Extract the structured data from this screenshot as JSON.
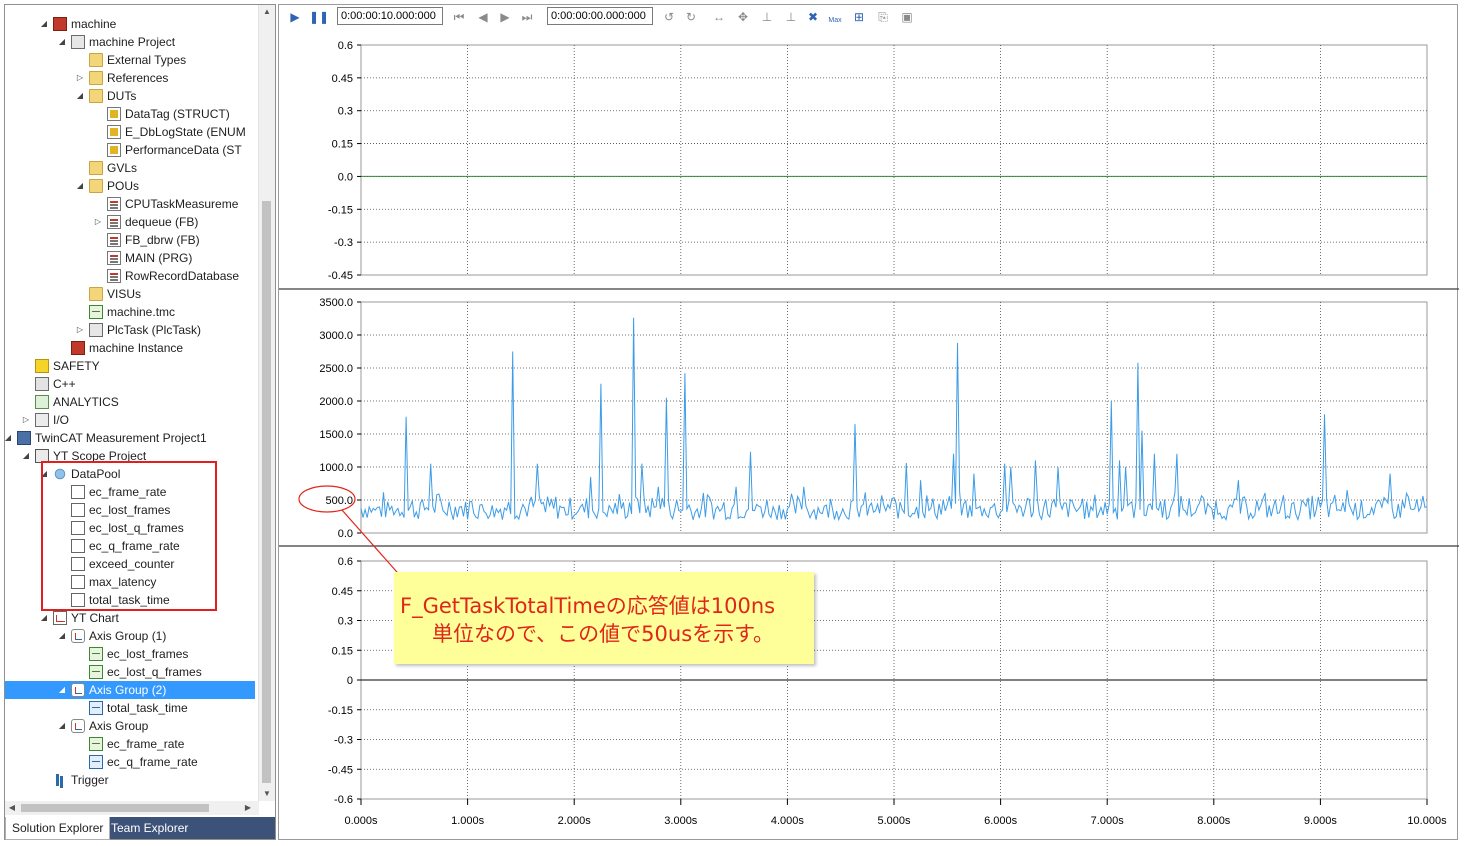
{
  "explorer": {
    "tree": [
      {
        "label": "machine",
        "icon": "plc-project-icon",
        "indent": 4,
        "toggle": "expanded",
        "y": 10
      },
      {
        "label": "machine Project",
        "icon": "project-icon",
        "indent": 5,
        "toggle": "expanded",
        "y": 28
      },
      {
        "label": "External Types",
        "icon": "folder-icon",
        "indent": 6,
        "toggle": "",
        "y": 46
      },
      {
        "label": "References",
        "icon": "references-icon",
        "indent": 6,
        "toggle": "collapsed",
        "y": 64
      },
      {
        "label": "DUTs",
        "icon": "folder-icon",
        "indent": 6,
        "toggle": "expanded",
        "y": 82
      },
      {
        "label": "DataTag (STRUCT)",
        "icon": "dut-icon",
        "indent": 7,
        "toggle": "",
        "y": 100
      },
      {
        "label": "E_DbLogState (ENUM",
        "icon": "dut-icon",
        "indent": 7,
        "toggle": "",
        "y": 118
      },
      {
        "label": "PerformanceData (ST",
        "icon": "dut-icon",
        "indent": 7,
        "toggle": "",
        "y": 136
      },
      {
        "label": "GVLs",
        "icon": "folder-icon",
        "indent": 6,
        "toggle": "",
        "y": 154
      },
      {
        "label": "POUs",
        "icon": "folder-icon",
        "indent": 6,
        "toggle": "expanded",
        "y": 172
      },
      {
        "label": "CPUTaskMeasureme",
        "icon": "pou-icon",
        "indent": 7,
        "toggle": "",
        "y": 190
      },
      {
        "label": "dequeue (FB)",
        "icon": "pou-icon",
        "indent": 7,
        "toggle": "collapsed",
        "y": 208
      },
      {
        "label": "FB_dbrw (FB)",
        "icon": "pou-icon",
        "indent": 7,
        "toggle": "",
        "y": 226
      },
      {
        "label": "MAIN (PRG)",
        "icon": "pou-icon",
        "indent": 7,
        "toggle": "",
        "y": 244
      },
      {
        "label": "RowRecordDatabase",
        "icon": "pou-icon",
        "indent": 7,
        "toggle": "",
        "y": 262
      },
      {
        "label": "VISUs",
        "icon": "folder-icon",
        "indent": 6,
        "toggle": "",
        "y": 280
      },
      {
        "label": "machine.tmc",
        "icon": "tmc-file-icon",
        "indent": 6,
        "toggle": "",
        "y": 298
      },
      {
        "label": "PlcTask (PlcTask)",
        "icon": "task-icon",
        "indent": 6,
        "toggle": "collapsed",
        "y": 316
      },
      {
        "label": "machine Instance",
        "icon": "instance-icon",
        "indent": 5,
        "toggle": "",
        "y": 334
      },
      {
        "label": "SAFETY",
        "icon": "safety-icon",
        "indent": 3,
        "toggle": "",
        "y": 352
      },
      {
        "label": "C++",
        "icon": "cpp-icon",
        "indent": 3,
        "toggle": "",
        "y": 370
      },
      {
        "label": "ANALYTICS",
        "icon": "analytics-icon",
        "indent": 3,
        "toggle": "",
        "y": 388
      },
      {
        "label": "I/O",
        "icon": "io-icon",
        "indent": 3,
        "toggle": "collapsed",
        "y": 406
      },
      {
        "label": "TwinCAT Measurement Project1",
        "icon": "measurement-project-icon",
        "indent": 2,
        "toggle": "expanded",
        "y": 424
      },
      {
        "label": "YT Scope Project",
        "icon": "scope-project-icon",
        "indent": 3,
        "toggle": "expanded",
        "y": 442
      },
      {
        "label": "DataPool",
        "icon": "datapool-icon",
        "indent": 4,
        "toggle": "expanded",
        "y": 460
      },
      {
        "label": "ec_frame_rate",
        "icon": "symbol-icon",
        "indent": 5,
        "toggle": "",
        "y": 478
      },
      {
        "label": "ec_lost_frames",
        "icon": "symbol-icon",
        "indent": 5,
        "toggle": "",
        "y": 496
      },
      {
        "label": "ec_lost_q_frames",
        "icon": "symbol-icon",
        "indent": 5,
        "toggle": "",
        "y": 514
      },
      {
        "label": "ec_q_frame_rate",
        "icon": "symbol-icon",
        "indent": 5,
        "toggle": "",
        "y": 532
      },
      {
        "label": "exceed_counter",
        "icon": "symbol-icon",
        "indent": 5,
        "toggle": "",
        "y": 550
      },
      {
        "label": "max_latency",
        "icon": "symbol-icon",
        "indent": 5,
        "toggle": "",
        "y": 568
      },
      {
        "label": "total_task_time",
        "icon": "symbol-icon",
        "indent": 5,
        "toggle": "",
        "y": 586
      },
      {
        "label": "YT Chart",
        "icon": "chart-icon",
        "indent": 4,
        "toggle": "expanded",
        "y": 604
      },
      {
        "label": "Axis Group (1)",
        "icon": "axis-group-icon",
        "indent": 5,
        "toggle": "expanded",
        "y": 622
      },
      {
        "label": "ec_lost_frames",
        "icon": "channel-green-icon",
        "indent": 6,
        "toggle": "",
        "y": 640
      },
      {
        "label": "ec_lost_q_frames",
        "icon": "channel-green-icon",
        "indent": 6,
        "toggle": "",
        "y": 658
      },
      {
        "label": "Axis Group (2)",
        "icon": "axis-group-icon",
        "indent": 5,
        "toggle": "expanded",
        "y": 676,
        "selected": true
      },
      {
        "label": "total_task_time",
        "icon": "channel-blue-icon",
        "indent": 6,
        "toggle": "",
        "y": 694
      },
      {
        "label": "Axis Group",
        "icon": "axis-group-icon",
        "indent": 5,
        "toggle": "expanded",
        "y": 712
      },
      {
        "label": "ec_frame_rate",
        "icon": "channel-green-icon",
        "indent": 6,
        "toggle": "",
        "y": 730
      },
      {
        "label": "ec_q_frame_rate",
        "icon": "channel-blue-icon",
        "indent": 6,
        "toggle": "",
        "y": 748
      },
      {
        "label": "Trigger",
        "icon": "trigger-icon",
        "indent": 4,
        "toggle": "",
        "y": 766
      }
    ],
    "tabs": {
      "solution": "Solution Explorer",
      "team": "Team Explorer"
    }
  },
  "toolbar": {
    "time_span": "0:00:00:10.000:000",
    "time_position": "0:00:00:00.000:000",
    "buttons": [
      "start-icon",
      "pause-icon",
      "go-first-icon",
      "step-back-icon",
      "step-forward-icon",
      "go-last-icon",
      "undo-icon",
      "redo-icon",
      "pan-icon",
      "zoom-all-icon",
      "cursor-icon",
      "cursor2-icon",
      "delete-cursor-icon",
      "max-icon",
      "marker-icon",
      "export-icon",
      "snapshot-icon"
    ],
    "max_label": "Max"
  },
  "chart_data": [
    {
      "type": "line",
      "name": "Axis Group (1)",
      "ylim": [
        -0.45,
        0.6
      ],
      "ytick_labels": [
        "0.6",
        "0.45",
        "0.3",
        "0.15",
        "0.0",
        "-0.15",
        "-0.3",
        "-0.45"
      ],
      "series": [
        {
          "name": "ec_lost_frames",
          "color": "#2e8b2e",
          "values": [
            0,
            0
          ]
        }
      ],
      "grid": true
    },
    {
      "type": "line",
      "name": "Axis Group (2)",
      "ylim": [
        0,
        3500
      ],
      "ytick_labels": [
        "3500.0",
        "3000.0",
        "2500.0",
        "2000.0",
        "1500.0",
        "1000.0",
        "500.0",
        "0.0"
      ],
      "series": [
        {
          "name": "total_task_time",
          "color": "#3d9ce8",
          "spikes": [
            [
              0.43,
              1760
            ],
            [
              0.66,
              1050
            ],
            [
              1.43,
              2750
            ],
            [
              1.65,
              1050
            ],
            [
              2.15,
              850
            ],
            [
              2.25,
              2260
            ],
            [
              2.56,
              3260
            ],
            [
              2.63,
              1050
            ],
            [
              2.78,
              700
            ],
            [
              2.87,
              2050
            ],
            [
              3.03,
              2420
            ],
            [
              3.52,
              700
            ],
            [
              3.65,
              1230
            ],
            [
              4.15,
              700
            ],
            [
              4.64,
              1650
            ],
            [
              5.11,
              1060
            ],
            [
              5.25,
              800
            ],
            [
              5.55,
              1200
            ],
            [
              5.6,
              2880
            ],
            [
              5.75,
              900
            ],
            [
              6.03,
              1050
            ],
            [
              6.1,
              1000
            ],
            [
              6.32,
              1100
            ],
            [
              6.53,
              1000
            ],
            [
              7.03,
              2000
            ],
            [
              7.11,
              1100
            ],
            [
              7.18,
              1000
            ],
            [
              7.29,
              2580
            ],
            [
              7.32,
              1550
            ],
            [
              7.45,
              1200
            ],
            [
              7.65,
              1200
            ],
            [
              8.23,
              800
            ],
            [
              9.03,
              1800
            ],
            [
              9.25,
              650
            ],
            [
              9.65,
              900
            ],
            [
              9.8,
              600
            ]
          ],
          "baseline_range": [
            200,
            650
          ]
        }
      ],
      "grid": true
    },
    {
      "type": "line",
      "name": "Axis Group",
      "ylim": [
        -0.6,
        0.6
      ],
      "ytick_labels": [
        "0.6",
        "0.45",
        "0.3",
        "0.15",
        "0",
        "-0.15",
        "-0.3",
        "-0.45",
        "-0.6"
      ],
      "series": [
        {
          "name": "ec_frame_rate",
          "color": "#000000",
          "values": [
            0,
            0
          ]
        }
      ],
      "grid": true
    }
  ],
  "xaxis": {
    "xlim": [
      0,
      10
    ],
    "tick_labels": [
      "0.000s",
      "1.000s",
      "2.000s",
      "3.000s",
      "4.000s",
      "5.000s",
      "6.000s",
      "7.000s",
      "8.000s",
      "9.000s",
      "10.000s"
    ]
  },
  "callout": {
    "line1": "F_GetTaskTotalTimeの応答値は100ns",
    "line2": "単位なので、この値で50usを示す。",
    "accent": "#e0261c",
    "background": "#ffff99"
  }
}
